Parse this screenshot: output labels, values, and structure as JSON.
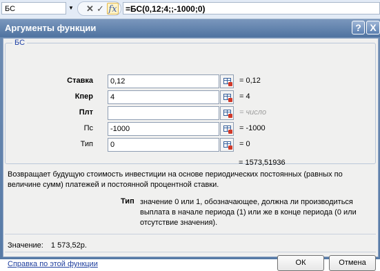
{
  "formula_bar": {
    "name_box": "БС",
    "formula": "=БС(0,12;4;;-1000;0)",
    "fx_label": "fx"
  },
  "dialog": {
    "title": "Аргументы функции",
    "help_glyph": "?",
    "close_glyph": "X",
    "function_group": "БС",
    "arguments": [
      {
        "label": "Ставка",
        "value": "0,12",
        "result": "= 0,12",
        "bold": true
      },
      {
        "label": "Кпер",
        "value": "4",
        "result": "= 4",
        "bold": true
      },
      {
        "label": "Плт",
        "value": "",
        "result": "= число",
        "bold": true
      },
      {
        "label": "Пс",
        "value": "-1000",
        "result": "= -1000",
        "bold": false
      },
      {
        "label": "Тип",
        "value": "0",
        "result": "= 0",
        "bold": false
      }
    ],
    "formula_result": "= 1573,51936",
    "description": "Возвращает будущую стоимость инвестиции на основе периодических постоянных (равных по величине сумм) платежей и постоянной процентной ставки.",
    "arg_help_label": "Тип",
    "arg_help_text": "значение 0 или 1, обозначающее, должна ли производиться выплата в начале периода (1) или же в конце периода (0 или отсутствие значения).",
    "value_label": "Значение:",
    "value": "1 573,52р.",
    "help_link": "Справка по этой функции",
    "ok_label": "ОК",
    "cancel_label": "Отмена"
  }
}
